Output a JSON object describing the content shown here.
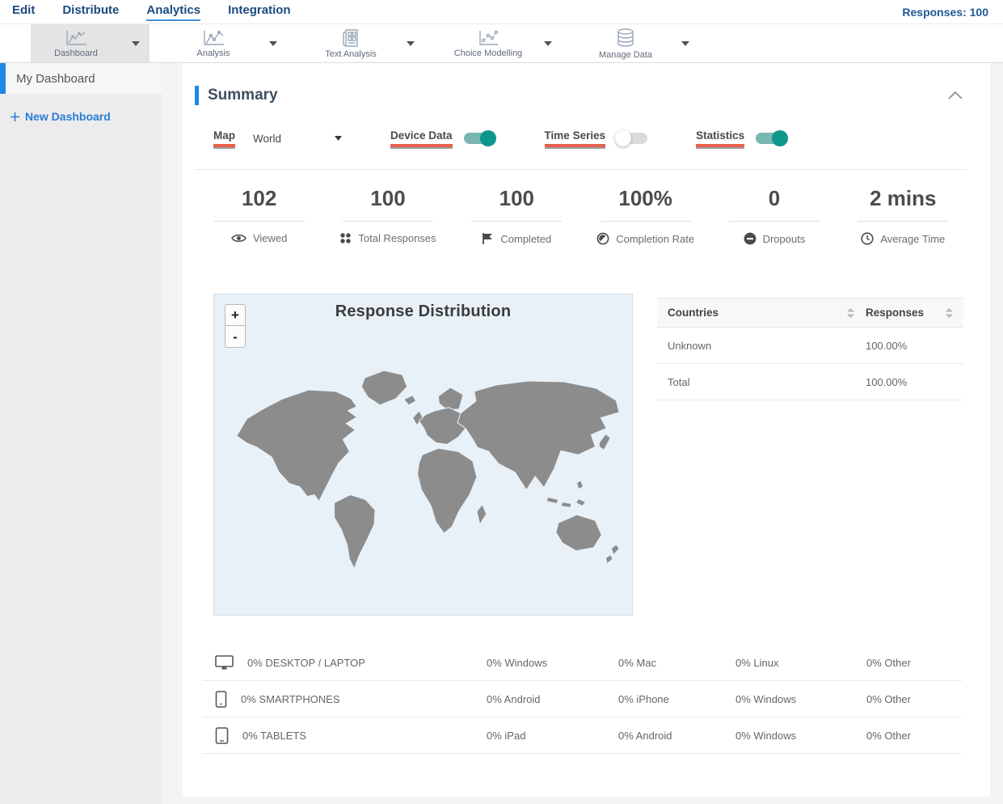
{
  "topnav": {
    "items": [
      {
        "label": "Edit"
      },
      {
        "label": "Distribute"
      },
      {
        "label": "Analytics",
        "active": true
      },
      {
        "label": "Integration"
      }
    ],
    "responses_label": "Responses: 100"
  },
  "toolbar": {
    "items": [
      {
        "label": "Dashboard",
        "icon": "line-chart",
        "active": true
      },
      {
        "label": "Analysis",
        "icon": "line-chart"
      },
      {
        "label": "Text Analysis",
        "icon": "document-grid"
      },
      {
        "label": "Choice Modelling",
        "icon": "scatter-chart"
      },
      {
        "label": "Manage Data",
        "icon": "database"
      }
    ]
  },
  "sidebar": {
    "items": [
      {
        "label": "My Dashboard",
        "active": true
      }
    ],
    "new_dashboard_label": "New Dashboard"
  },
  "summary": {
    "title": "Summary",
    "controls": {
      "map_label": "Map",
      "map_value": "World",
      "device_data_label": "Device Data",
      "device_data_on": true,
      "time_series_label": "Time Series",
      "time_series_on": false,
      "statistics_label": "Statistics",
      "statistics_on": true
    },
    "stats": [
      {
        "value": "102",
        "label": "Viewed",
        "icon": "eye"
      },
      {
        "value": "100",
        "label": "Total Responses",
        "icon": "dot-grid"
      },
      {
        "value": "100",
        "label": "Completed",
        "icon": "flag"
      },
      {
        "value": "100%",
        "label": "Completion Rate",
        "icon": "contrast-circle"
      },
      {
        "value": "0",
        "label": "Dropouts",
        "icon": "minus-circle"
      },
      {
        "value": "2 mins",
        "label": "Average Time",
        "icon": "clock"
      }
    ],
    "map": {
      "title": "Response Distribution",
      "zoom_in_label": "+",
      "zoom_out_label": "-",
      "region": "World"
    },
    "countries_table": {
      "columns": [
        "Countries",
        "Responses"
      ],
      "rows": [
        {
          "country": "Unknown",
          "responses": "100.00%"
        },
        {
          "country": "Total",
          "responses": "100.00%"
        }
      ]
    },
    "devices": [
      {
        "icon": "desktop",
        "label": "0% DESKTOP / LAPTOP",
        "cols": [
          "0% Windows",
          "0% Mac",
          "0% Linux",
          "0% Other"
        ]
      },
      {
        "icon": "smartphone",
        "label": "0% SMARTPHONES",
        "cols": [
          "0% Android",
          "0% iPhone",
          "0% Windows",
          "0% Other"
        ]
      },
      {
        "icon": "tablet",
        "label": "0% TABLETS",
        "cols": [
          "0% iPad",
          "0% Android",
          "0% Windows",
          "0% Other"
        ]
      }
    ]
  },
  "colors": {
    "accent_blue": "#1e88e5",
    "nav_blue": "#1b4a7e",
    "link_blue": "#2a7cd5",
    "toggle_on_knob": "#0e968b",
    "toggle_on_track": "#79b6b1",
    "marker_red": "#e8604c",
    "map_land": "#8c8c8c",
    "map_ocean": "#e8f1f8"
  }
}
